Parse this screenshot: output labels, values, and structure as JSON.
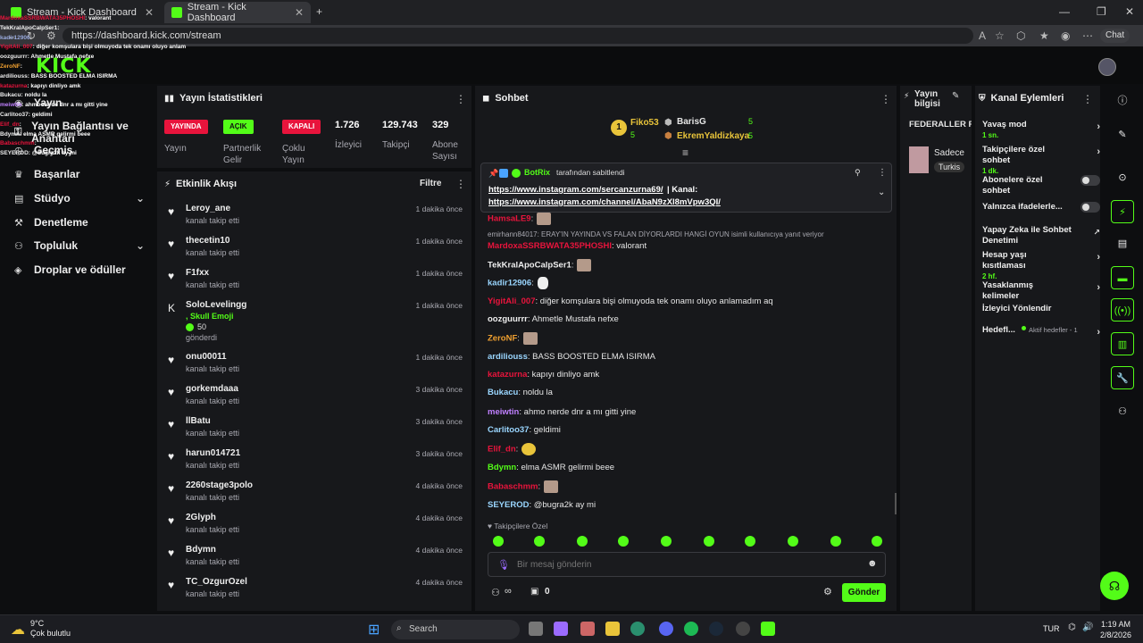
{
  "browser": {
    "tabs": [
      {
        "label": "Stream - Kick Dashboard"
      },
      {
        "label": "Stream - Kick Dashboard"
      }
    ],
    "url": "https://dashboard.kick.com/stream",
    "chat_label": "Chat"
  },
  "logo_text": "KICK",
  "nav": [
    {
      "label": "Yayın"
    },
    {
      "label": "Yayın Bağlantısı ve Anahtarı"
    },
    {
      "label": "Geçmiş"
    },
    {
      "label": "Başarılar"
    },
    {
      "label": "Stüdyo"
    },
    {
      "label": "Denetleme"
    },
    {
      "label": "Topluluk"
    },
    {
      "label": "Droplar ve ödüller"
    }
  ],
  "overlay_lines": [
    {
      "user": "MardoxaSSRBWATA35PHOSHI",
      "text": ": valorant",
      "color": "#e8143c"
    },
    {
      "user": "TekKralApoCalpSer1",
      "text": ":",
      "color": "#eeeeee"
    },
    {
      "user": "kadir12906",
      "text": ":",
      "color": "#9ad"
    },
    {
      "user": "YigitAli_007",
      "text": ": diğer komşulara bişi olmuyoda tek onamı oluyo anlam",
      "color": "#e8143c"
    },
    {
      "user": "oozguurrr",
      "text": ": Ahmetle Mustafa nefxe",
      "color": "#eeeeee"
    },
    {
      "user": "ZeroNF",
      "text": ":",
      "color": "#f0a030"
    },
    {
      "user": "ardiliouss",
      "text": ": BASS BOOSTED ELMA ISIRMA",
      "color": "#eeeeee"
    },
    {
      "user": "katazurna",
      "text": ": kapıyı dinliyo amk",
      "color": "#e8143c"
    },
    {
      "user": "Bukacu",
      "text": ": noldu la",
      "color": "#eeeeee"
    },
    {
      "user": "meiwtin",
      "text": ": ahmo nerde dnr a mı gitti yine",
      "color": "#c080ff"
    },
    {
      "user": "Carlitoo37",
      "text": ": geldimi",
      "color": "#eeeeee"
    },
    {
      "user": "Elif_dn",
      "text": ":",
      "color": "#e8143c"
    },
    {
      "user": "Bdymn",
      "text": ": elma ASMR gelirmi beee",
      "color": "#eeeeee"
    },
    {
      "user": "Babaschmm",
      "text": ":",
      "color": "#e8143c"
    },
    {
      "user": "SEYEROD",
      "text": ": @bugra2k ay mi",
      "color": "#eeeeee"
    }
  ],
  "stats": {
    "title": "Yayın İstatistikleri",
    "badges": [
      {
        "text": "YAYINDA",
        "label": "Yayın"
      },
      {
        "text": "AÇIK",
        "label": "Partnerlik Gelir"
      },
      {
        "text": "KAPALI",
        "label": "Çoklu Yayın"
      }
    ],
    "numbers": [
      {
        "value": "1.726",
        "label": "İzleyici"
      },
      {
        "value": "129.743",
        "label": "Takipçi"
      },
      {
        "value": "329",
        "label": "Abone Sayısı"
      }
    ]
  },
  "activity": {
    "title": "Etkinlik Akışı",
    "filter_label": "Filtre",
    "items": [
      {
        "name": "Leroy_ane",
        "sub": "kanalı takip etti",
        "time": "1 dakika önce",
        "icon": "♥"
      },
      {
        "name": "thecetin10",
        "sub": "kanalı takip etti",
        "time": "1 dakika önce",
        "icon": "♥"
      },
      {
        "name": "F1fxx",
        "sub": "kanalı takip etti",
        "time": "1 dakika önce",
        "icon": "♥"
      },
      {
        "name": "SoloLevelingg",
        "sub": "gönderdi",
        "time": "1 dakika önce",
        "icon": "K",
        "extra": ", Skull Emoji",
        "amount": "50"
      },
      {
        "name": "onu00011",
        "sub": "kanalı takip etti",
        "time": "1 dakika önce",
        "icon": "♥"
      },
      {
        "name": "gorkemdaaa",
        "sub": "kanalı takip etti",
        "time": "3 dakika önce",
        "icon": "♥"
      },
      {
        "name": "llBatu",
        "sub": "kanalı takip etti",
        "time": "3 dakika önce",
        "icon": "♥"
      },
      {
        "name": "harun014721",
        "sub": "kanalı takip etti",
        "time": "3 dakika önce",
        "icon": "♥"
      },
      {
        "name": "2260stage3polo",
        "sub": "kanalı takip etti",
        "time": "4 dakika önce",
        "icon": "♥"
      },
      {
        "name": "2Glyph",
        "sub": "kanalı takip etti",
        "time": "4 dakika önce",
        "icon": "♥"
      },
      {
        "name": "Bdymn",
        "sub": "kanalı takip etti",
        "time": "4 dakika önce",
        "icon": "♥"
      },
      {
        "name": "TC_OzgurOzel",
        "sub": "kanalı takip etti",
        "time": "4 dakika önce",
        "icon": "♥"
      }
    ]
  },
  "chat": {
    "title": "Sohbet",
    "leaders": [
      {
        "name": "Fiko53",
        "count": "5"
      },
      {
        "name": "BarisG",
        "count": "5"
      },
      {
        "name": "EkremYaldizkaya",
        "count": "5"
      }
    ],
    "pinned": {
      "by": "BotRix",
      "by_suffix": "tarafından sabitlendi",
      "link1": "https://www.instagram.com/sercanzurna69/",
      "mid": " | Kanal:",
      "link2": "https://www.instagram.com/channel/AbaN9zXl8mVpw3QI/"
    },
    "reply_note": "emirhann84017: ERAY'IN YAYINDA VS FALAN DİYORLARDI HANGİ OYUN isimli kullanıcıya yanıt veriyor",
    "messages": [
      {
        "user": "HamsaLE9",
        "text": "",
        "color": "#e8143c",
        "emote": "p"
      },
      {
        "user": "MardoxaSSRBWATA35PHOSHI",
        "text": " valorant",
        "color": "#e8143c"
      },
      {
        "user": "TekKralApoCalpSer1",
        "text": "",
        "color": "#eeeeee",
        "emote": "p"
      },
      {
        "user": "kadir12906",
        "text": "",
        "color": "#9ad6ff",
        "emote": "w"
      },
      {
        "user": "YigitAli_007",
        "text": " diğer komşulara bişi olmuyoda tek onamı oluyo anlamadım aq",
        "color": "#e8143c"
      },
      {
        "user": "oozguurrr",
        "text": " Ahmetle Mustafa nefxe",
        "color": "#eeeeee"
      },
      {
        "user": "ZeroNF",
        "text": "",
        "color": "#f0a030",
        "emote": "p"
      },
      {
        "user": "ardiliouss",
        "text": " BASS BOOSTED ELMA ISIRMA",
        "color": "#9ad6ff"
      },
      {
        "user": "katazurna",
        "text": " kapıyı dinliyo amk",
        "color": "#e8143c"
      },
      {
        "user": "Bukacu",
        "text": " noldu la",
        "color": "#9ad6ff"
      },
      {
        "user": "meiwtin",
        "text": " ahmo nerde dnr a mı gitti yine",
        "color": "#c080ff"
      },
      {
        "user": "Carlitoo37",
        "text": " geldimi",
        "color": "#9ad6ff"
      },
      {
        "user": "Elif_dn",
        "text": "",
        "color": "#e8143c",
        "emote": "y"
      },
      {
        "user": "Bdymn",
        "text": " elma ASMR gelirmi beee",
        "color": "#53fc18"
      },
      {
        "user": "Babaschmm",
        "text": "",
        "color": "#e8143c",
        "emote": "p"
      },
      {
        "user": "SEYEROD",
        "text": " @bugra2k ay mi",
        "color": "#9ad6ff"
      }
    ],
    "followers_only": "Takipçilere Özel",
    "input_placeholder": "Bir mesaj gönderin",
    "count_left": "∞",
    "count_right": "0",
    "send_label": "Gönder"
  },
  "stream_info": {
    "title": "Yayın bilgisi",
    "stream_title": "FEDERALLER PEŞİMDE |...",
    "category": "Sadece",
    "language": "Turkis"
  },
  "channel_actions": {
    "title": "Kanal Eylemleri",
    "items": [
      {
        "label": "Yavaş mod",
        "sub": "1 sn.",
        "control": "chevron"
      },
      {
        "label": "Takipçilere özel sohbet",
        "sub": "1 dk.",
        "control": "chevron"
      },
      {
        "label": "Abonelere özel sohbet",
        "sub": "",
        "control": "toggle"
      },
      {
        "label": "Yalnızca ifadelerle...",
        "sub": "",
        "control": "toggle"
      },
      {
        "label": "Yapay Zeka ile Sohbet Denetimi",
        "sub": "",
        "control": "external"
      },
      {
        "label": "Hesap yaşı kısıtlaması",
        "sub": "2 hf.",
        "control": "chevron"
      },
      {
        "label": "Yasaklanmış kelimeler",
        "sub": "",
        "control": "chevron"
      },
      {
        "label": "İzleyici Yönlendir",
        "sub": "",
        "control": "none"
      },
      {
        "label": "Hedefl...",
        "sub": "",
        "control": "chevron",
        "note": "Aktif hedefler - 1"
      }
    ]
  },
  "taskbar": {
    "temp": "9°C",
    "weather": "Çok bulutlu",
    "search": "Search",
    "lang": "TUR",
    "time": "1:19 AM",
    "date": "2/8/2026"
  },
  "colors": {
    "accent": "#53fc18",
    "live": "#e8143c",
    "panel": "#17181b"
  }
}
